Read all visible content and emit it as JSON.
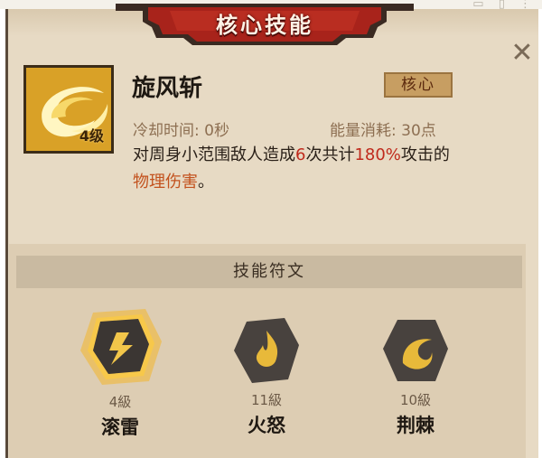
{
  "title": "核心技能",
  "skill": {
    "name": "旋风斩",
    "level": "4级",
    "core_badge": "核心",
    "cooldown": "冷却时间: 0秒",
    "energy": "能量消耗: 30点",
    "desc": {
      "p1": "对周身小范围敌人造成",
      "n1": "6",
      "p2": "次共计",
      "n2": "180%",
      "p3": "攻击的",
      "dmg": "物理伤害",
      "end": "。"
    }
  },
  "runes": {
    "header": "技能符文",
    "items": [
      {
        "level": "4級",
        "name": "滚雷",
        "icon": "thunder-rune-icon",
        "selected": true
      },
      {
        "level": "11級",
        "name": "火怒",
        "icon": "fire-rune-icon",
        "selected": false
      },
      {
        "level": "10級",
        "name": "荆棘",
        "icon": "thorn-rune-icon",
        "selected": false
      }
    ]
  },
  "colors": {
    "panel": "#e7dac4",
    "banner_red": "#a8231b",
    "gold": "#e9b73a",
    "highlight_red": "#c02a1c",
    "damage_orange": "#c3521e"
  }
}
